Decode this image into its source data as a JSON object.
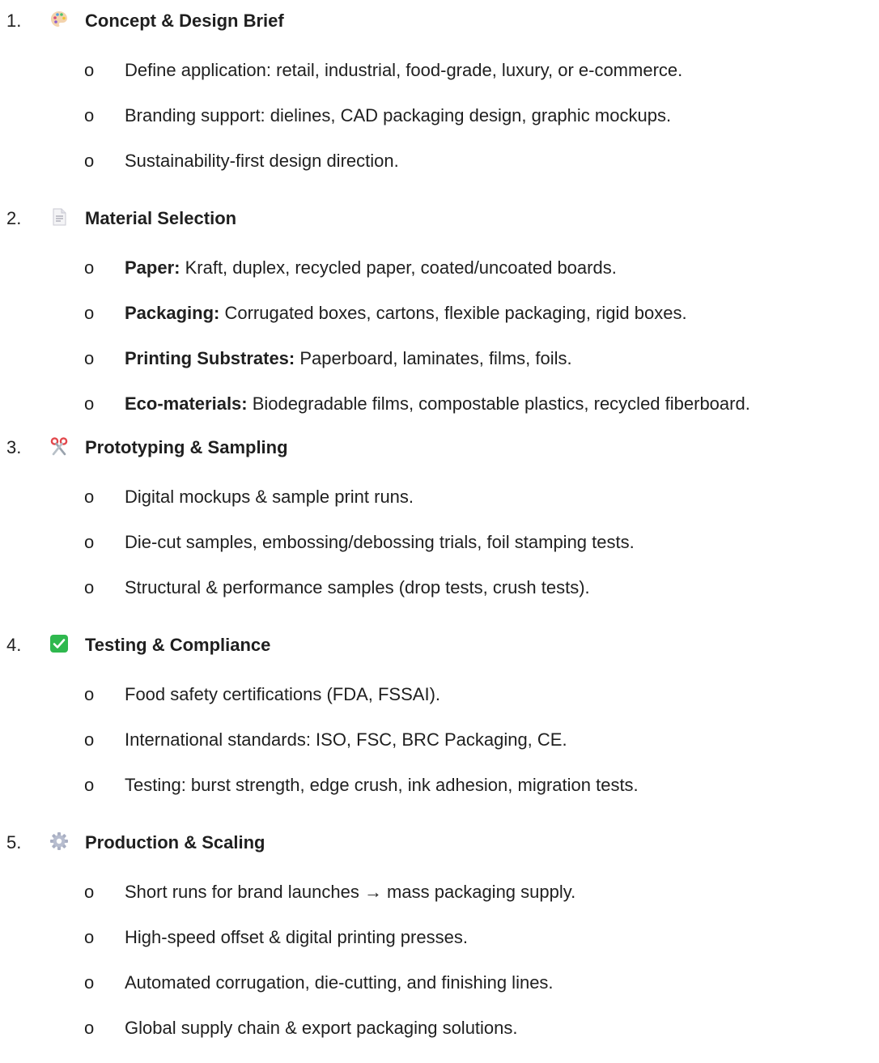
{
  "sections": [
    {
      "number": "1.",
      "icon": "palette-icon",
      "title": "Concept & Design Brief",
      "items": [
        {
          "bold": "",
          "text": "Define application: retail, industrial, food-grade, luxury, or e-commerce."
        },
        {
          "bold": "",
          "text": "Branding support: dielines, CAD packaging design, graphic mockups."
        },
        {
          "bold": "",
          "text": "Sustainability-first design direction."
        }
      ]
    },
    {
      "number": "2.",
      "icon": "document-icon",
      "title": "Material Selection",
      "items": [
        {
          "bold": "Paper:",
          "text": " Kraft, duplex, recycled paper, coated/uncoated boards."
        },
        {
          "bold": "Packaging:",
          "text": " Corrugated boxes, cartons, flexible packaging, rigid boxes."
        },
        {
          "bold": "Printing Substrates:",
          "text": " Paperboard, laminates, films, foils."
        },
        {
          "bold": "Eco-materials:",
          "text": " Biodegradable films, compostable plastics, recycled fiberboard."
        }
      ]
    },
    {
      "number": "3.",
      "icon": "scissors-icon",
      "title": "Prototyping & Sampling",
      "items": [
        {
          "bold": "",
          "text": "Digital mockups & sample print runs."
        },
        {
          "bold": "",
          "text": "Die-cut samples, embossing/debossing trials, foil stamping tests."
        },
        {
          "bold": "",
          "text": "Structural & performance samples (drop tests, crush tests)."
        }
      ]
    },
    {
      "number": "4.",
      "icon": "check-mark-icon",
      "title": "Testing & Compliance",
      "items": [
        {
          "bold": "",
          "text": "Food safety certifications (FDA, FSSAI)."
        },
        {
          "bold": "",
          "text": "International standards: ISO, FSC, BRC Packaging, CE."
        },
        {
          "bold": "",
          "text": "Testing: burst strength, edge crush, ink adhesion, migration tests."
        }
      ]
    },
    {
      "number": "5.",
      "icon": "gear-icon",
      "title": "Production & Scaling",
      "items": [
        {
          "bold": "",
          "text": "Short runs for brand launches → mass packaging supply."
        },
        {
          "bold": "",
          "text": "High-speed offset & digital printing presses."
        },
        {
          "bold": "",
          "text": "Automated corrugation, die-cutting, and finishing lines."
        },
        {
          "bold": "",
          "text": "Global supply chain & export packaging solutions."
        }
      ]
    }
  ],
  "bullet_glyph": "o",
  "colors": {
    "text": "#1f1f1f",
    "check": "#2fb84e"
  }
}
